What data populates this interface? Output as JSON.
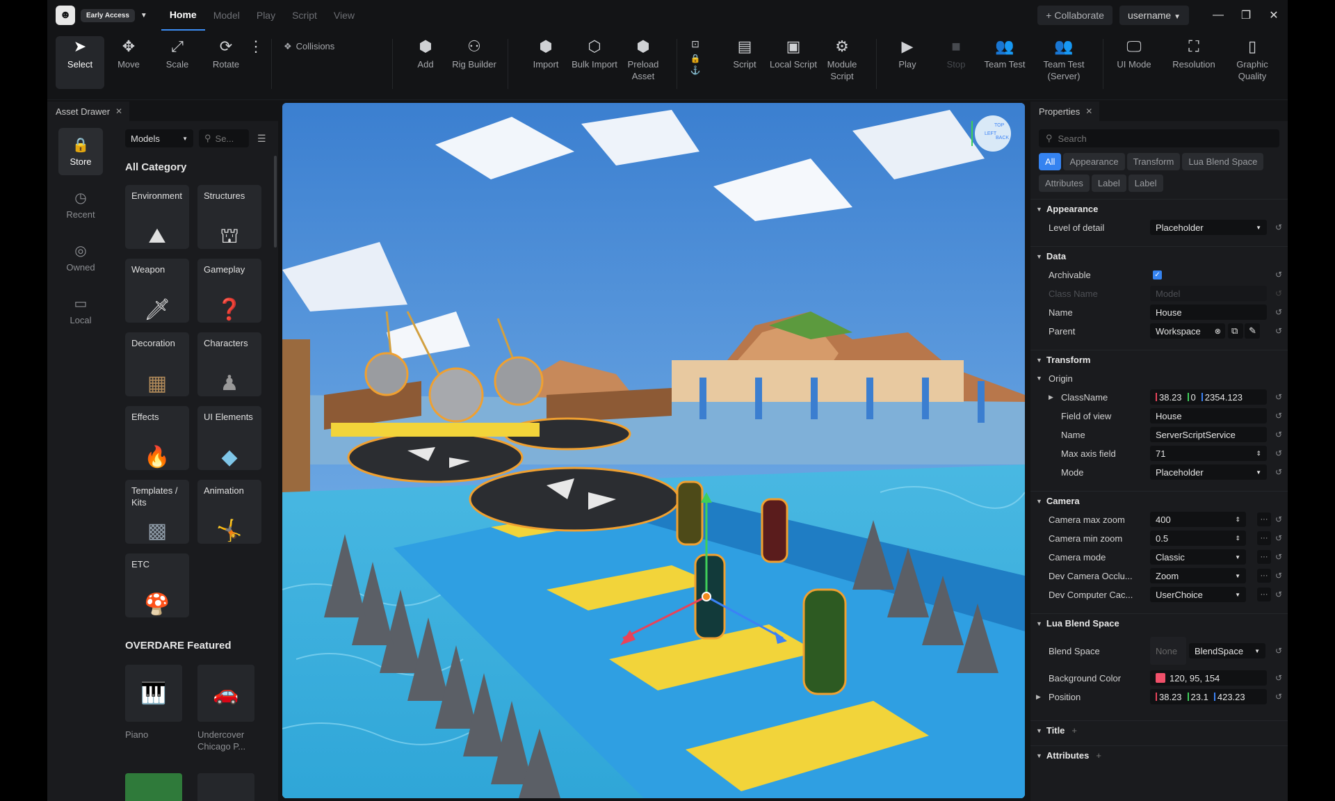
{
  "titlebar": {
    "badge": "Early Access",
    "menu": [
      "Home",
      "Model",
      "Play",
      "Script",
      "View"
    ],
    "collaborate": "+ Collaborate",
    "username": "username"
  },
  "toolbar": {
    "select": "Select",
    "move": "Move",
    "scale": "Scale",
    "rotate": "Rotate",
    "collisions": "Collisions",
    "add": "Add",
    "rig_builder": "Rig Builder",
    "import": "Import",
    "bulk_import": "Bulk Import",
    "preload_asset": "Preload Asset",
    "script": "Script",
    "local_script": "Local Script",
    "module_script": "Module Script",
    "play": "Play",
    "stop": "Stop",
    "team_test": "Team Test",
    "team_test_server": "Team Test (Server)",
    "ui_mode": "UI Mode",
    "resolution": "Resolution",
    "graphic_quality": "Graphic Quality"
  },
  "asset_drawer": {
    "title": "Asset Drawer",
    "nav": [
      "Store",
      "Recent",
      "Owned",
      "Local"
    ],
    "dropdown": "Models",
    "search_placeholder": "Se...",
    "all_category": "All Category",
    "categories": [
      "Environment",
      "Structures",
      "Weapon",
      "Gameplay",
      "Decoration",
      "Characters",
      "Effects",
      "UI Elements",
      "Templates / Kits",
      "Animation",
      "ETC"
    ],
    "featured_title": "OVERDARE Featured",
    "featured": [
      "Piano",
      "Undercover Chicago P..."
    ]
  },
  "viewport": {
    "gizmo": {
      "top": "TOP",
      "left": "LEFT",
      "back": "BACK"
    }
  },
  "properties": {
    "title": "Properties",
    "search_placeholder": "Search",
    "tabs": [
      "All",
      "Appearance",
      "Transform",
      "Lua Blend Space",
      "Attributes",
      "Label",
      "Label"
    ],
    "appearance": {
      "section": "Appearance",
      "level_of_detail": "Level of detail",
      "level_of_detail_value": "Placeholder"
    },
    "data": {
      "section": "Data",
      "archivable": "Archivable",
      "class_name": "Class Name",
      "class_name_value": "Model",
      "name": "Name",
      "name_value": "House",
      "parent": "Parent",
      "parent_value": "Workspace"
    },
    "transform": {
      "section": "Transform",
      "origin": "Origin",
      "classname": "ClassName",
      "classname_x": "38.23",
      "classname_y": "0",
      "classname_z": "2354.123",
      "fov": "Field of view",
      "fov_value": "House",
      "name": "Name",
      "name_value": "ServerScriptService",
      "max_axis": "Max axis field",
      "max_axis_value": "71",
      "mode": "Mode",
      "mode_value": "Placeholder"
    },
    "camera": {
      "section": "Camera",
      "max_zoom": "Camera max zoom",
      "max_zoom_value": "400",
      "min_zoom": "Camera min zoom",
      "min_zoom_value": "0.5",
      "mode": "Camera mode",
      "mode_value": "Classic",
      "occlusion": "Dev Camera Occlu...",
      "occlusion_value": "Zoom",
      "computer": "Dev Computer Cac...",
      "computer_value": "UserChoice"
    },
    "lua_blend": {
      "section": "Lua Blend Space",
      "blend_space": "Blend Space",
      "none": "None",
      "blend_space_value": "BlendSpace",
      "bg_color": "Background Color",
      "bg_color_value": "120, 95, 154",
      "bg_color_swatch": "#f0506a",
      "position": "Position",
      "pos_x": "38.23",
      "pos_y": "23.1",
      "pos_z": "423.23"
    },
    "title_section": "Title",
    "attributes_section": "Attributes"
  },
  "colors": {
    "accent": "#3583f0",
    "axis_x": "#e8435a",
    "axis_y": "#3fcf5a",
    "axis_z": "#3b82f6"
  }
}
